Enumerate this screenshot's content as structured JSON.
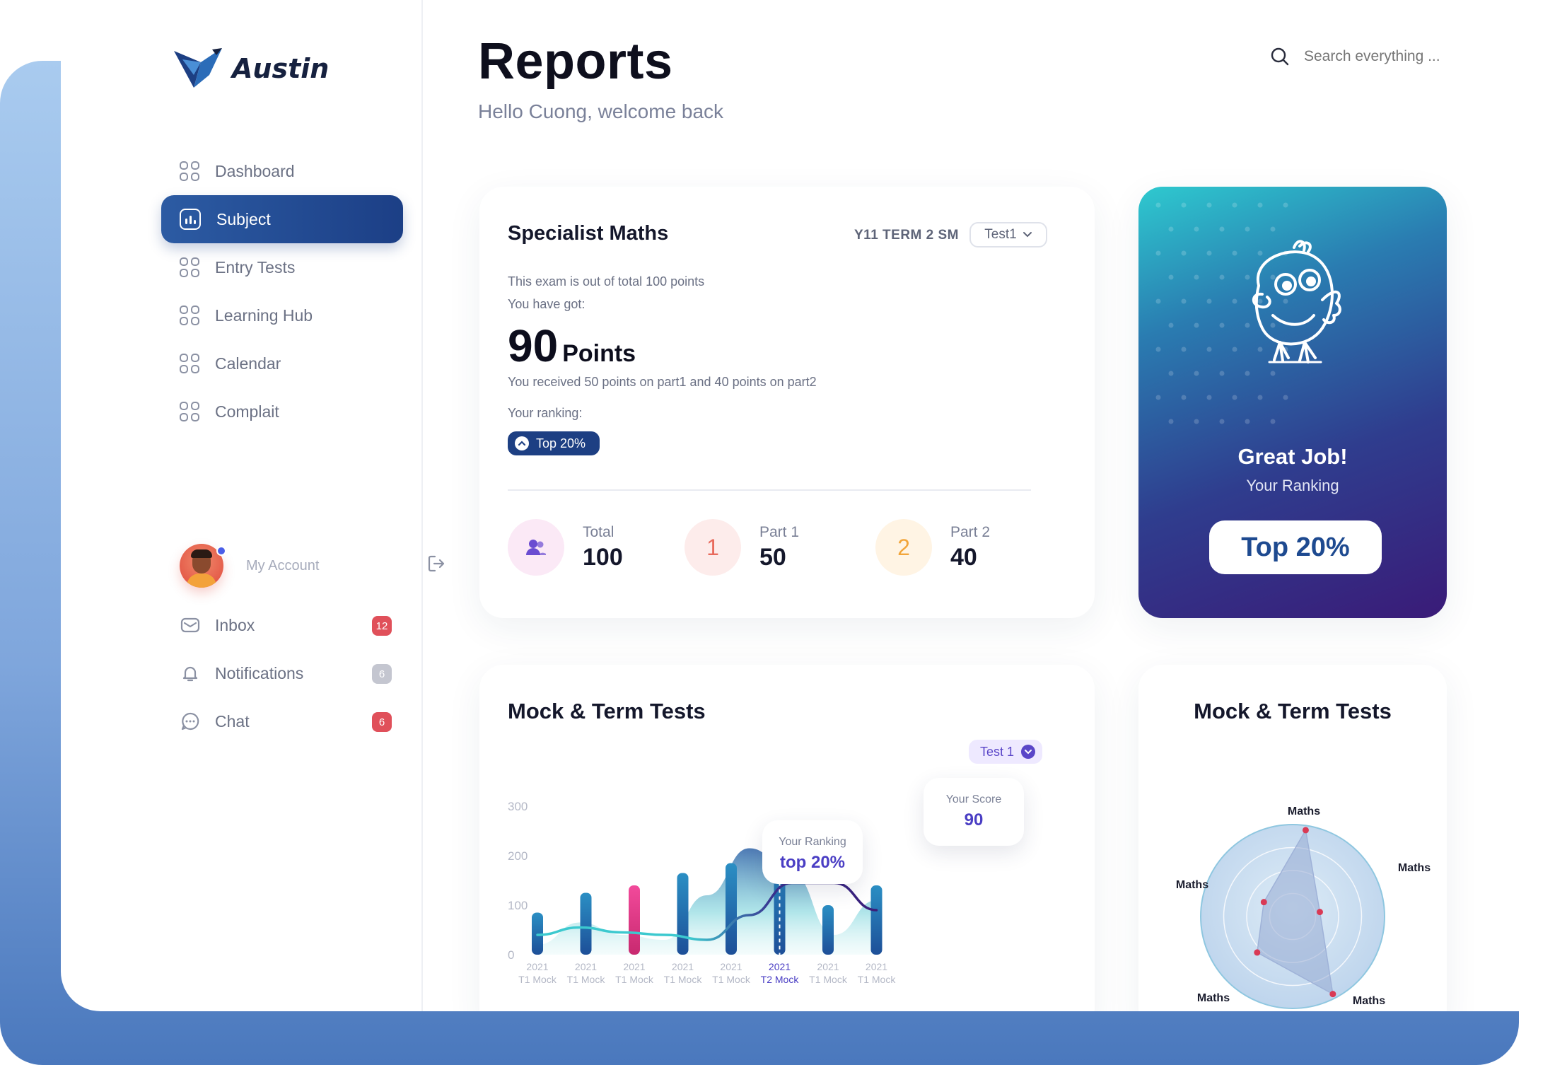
{
  "brand": {
    "name": "Austin"
  },
  "sidebar": {
    "items": [
      {
        "label": "Dashboard",
        "icon": "grid-icon",
        "active": false
      },
      {
        "label": "Subject",
        "icon": "chart-icon",
        "active": true
      },
      {
        "label": "Entry Tests",
        "icon": "grid-icon",
        "active": false
      },
      {
        "label": "Learning Hub",
        "icon": "grid-icon",
        "active": false
      },
      {
        "label": "Calendar",
        "icon": "grid-icon",
        "active": false
      },
      {
        "label": "Complait",
        "icon": "grid-icon",
        "active": false
      }
    ],
    "account_label": "My Account",
    "sub_items": [
      {
        "label": "Inbox",
        "icon": "mail-icon",
        "count": "12",
        "badge_color": "#e0505a"
      },
      {
        "label": "Notifications",
        "icon": "bell-icon",
        "count": "6",
        "badge_color": "#c4c6d0"
      },
      {
        "label": "Chat",
        "icon": "chat-icon",
        "count": "6",
        "badge_color": "#e0505a"
      }
    ]
  },
  "header": {
    "title": "Reports",
    "subtitle": "Hello Cuong, welcome back",
    "search_placeholder": "Search everything ..."
  },
  "specialist": {
    "title": "Specialist Maths",
    "term": "Y11  TERM 2  SM",
    "select_value": "Test1",
    "out_of_text": "This exam is out of total 100 points",
    "got_text": "You have got:",
    "points": "90",
    "points_unit": "Points",
    "breakdown_text": "You received 50 points on part1 and 40 points on part2",
    "ranking_label": "Your ranking:",
    "ranking_value": "Top 20%",
    "stats": [
      {
        "label": "Total",
        "value": "100",
        "icon": "users-icon",
        "circle_color": "#fbe9f6",
        "glyph": ""
      },
      {
        "label": "Part 1",
        "value": "50",
        "icon": "number-one-icon",
        "circle_color": "#fdeceb",
        "glyph": "1",
        "glyph_color": "#e86a5c"
      },
      {
        "label": "Part 2",
        "value": "40",
        "icon": "number-two-icon",
        "circle_color": "#fff4e4",
        "glyph": "2",
        "glyph_color": "#f2a53a"
      }
    ]
  },
  "ranking_card": {
    "headline": "Great Job!",
    "subline": "Your Ranking",
    "value": "Top 20%"
  },
  "mock_chart": {
    "title": "Mock & Term Tests",
    "chip": "Test 1",
    "tooltip_ranking_label": "Your Ranking",
    "tooltip_ranking_value": "top 20%",
    "tooltip_score_label": "Your Score",
    "tooltip_score_value": "90"
  },
  "chart_data": [
    {
      "type": "bar",
      "title": "Mock & Term Tests",
      "ylim": [
        0,
        300
      ],
      "yticks": [
        "0",
        "100",
        "200",
        "300"
      ],
      "categories": [
        {
          "year": "2021",
          "name": "T1 Mock"
        },
        {
          "year": "2021",
          "name": "T1 Mock"
        },
        {
          "year": "2021",
          "name": "T1 Mock"
        },
        {
          "year": "2021",
          "name": "T1 Mock"
        },
        {
          "year": "2021",
          "name": "T1 Mock"
        },
        {
          "year": "2021",
          "name": "T2 Mock"
        },
        {
          "year": "2021",
          "name": "T1 Mock"
        },
        {
          "year": "2021",
          "name": "T1 Mock"
        }
      ],
      "highlight_index": 5,
      "bars": [
        85,
        125,
        140,
        165,
        185,
        215,
        100,
        140
      ],
      "bar_colors": [
        "blue",
        "blue",
        "pink",
        "blue",
        "blue",
        "blue",
        "blue",
        "blue"
      ],
      "area": [
        20,
        65,
        40,
        30,
        120,
        215,
        165,
        40,
        110
      ],
      "line": [
        40,
        55,
        45,
        40,
        30,
        80,
        145,
        145,
        90
      ]
    },
    {
      "type": "radar",
      "title": "Mock & Term Tests",
      "axis_labels": [
        "Maths",
        "Maths",
        "Maths",
        "Maths",
        "Maths"
      ],
      "values": [
        0.95,
        0.3,
        0.95,
        0.55,
        0.35
      ],
      "rings": 4
    }
  ],
  "colors": {
    "accent": "#1d3f83",
    "purple": "#4a3ec4",
    "bar_blue": "#1f5fa0",
    "bar_pink": "#e2438f",
    "area_teal": "#6fd0d8",
    "line_dark": "#3a1f7a"
  }
}
